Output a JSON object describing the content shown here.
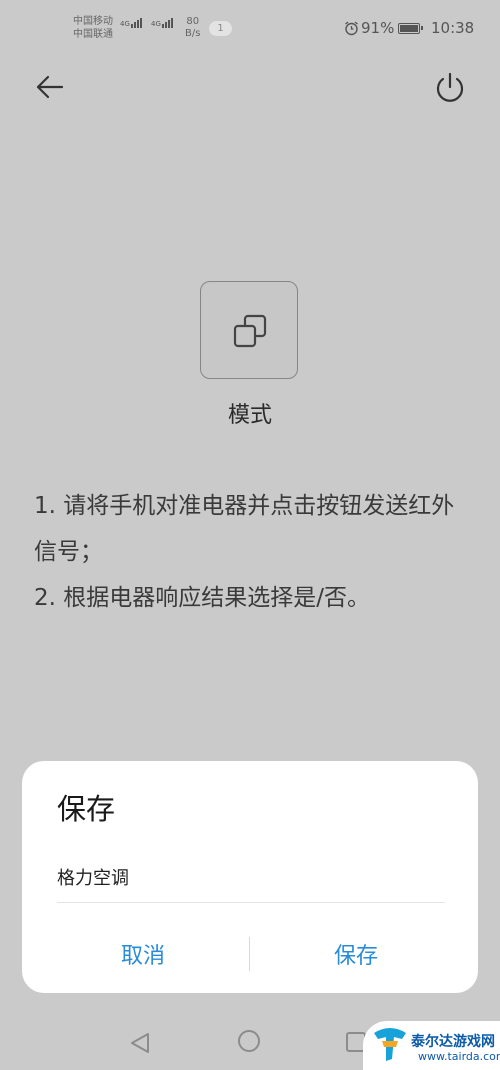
{
  "status_bar": {
    "carrier_1": "中国移动",
    "carrier_2": "中国联通",
    "network_1": "4G",
    "network_2": "4G",
    "net_speed_value": "80",
    "net_speed_unit": "B/s",
    "notification_count": "1",
    "battery_percent": "91%",
    "battery_level": 0.91,
    "time": "10:38",
    "icons": [
      "alarm-icon",
      "battery-icon",
      "signal-icon"
    ]
  },
  "header": {
    "back_icon": "arrow-left-icon",
    "power_icon": "power-icon"
  },
  "mode": {
    "icon": "mode-switch-icon",
    "label": "模式"
  },
  "instructions": {
    "line_1": "1. 请将手机对准电器并点击按钮发送红外信号；",
    "line_2": "2. 根据电器响应结果选择是/否。"
  },
  "dialog": {
    "title": "保存",
    "input_value": "格力空调",
    "cancel_label": "取消",
    "save_label": "保存",
    "accent_color": "#2a8bd8"
  },
  "nav_bar": {
    "icons": [
      "nav-back-icon",
      "nav-home-icon",
      "nav-recent-icon"
    ]
  },
  "watermark": {
    "name": "泰尔达游戏网",
    "url": "www.tairda.com"
  }
}
